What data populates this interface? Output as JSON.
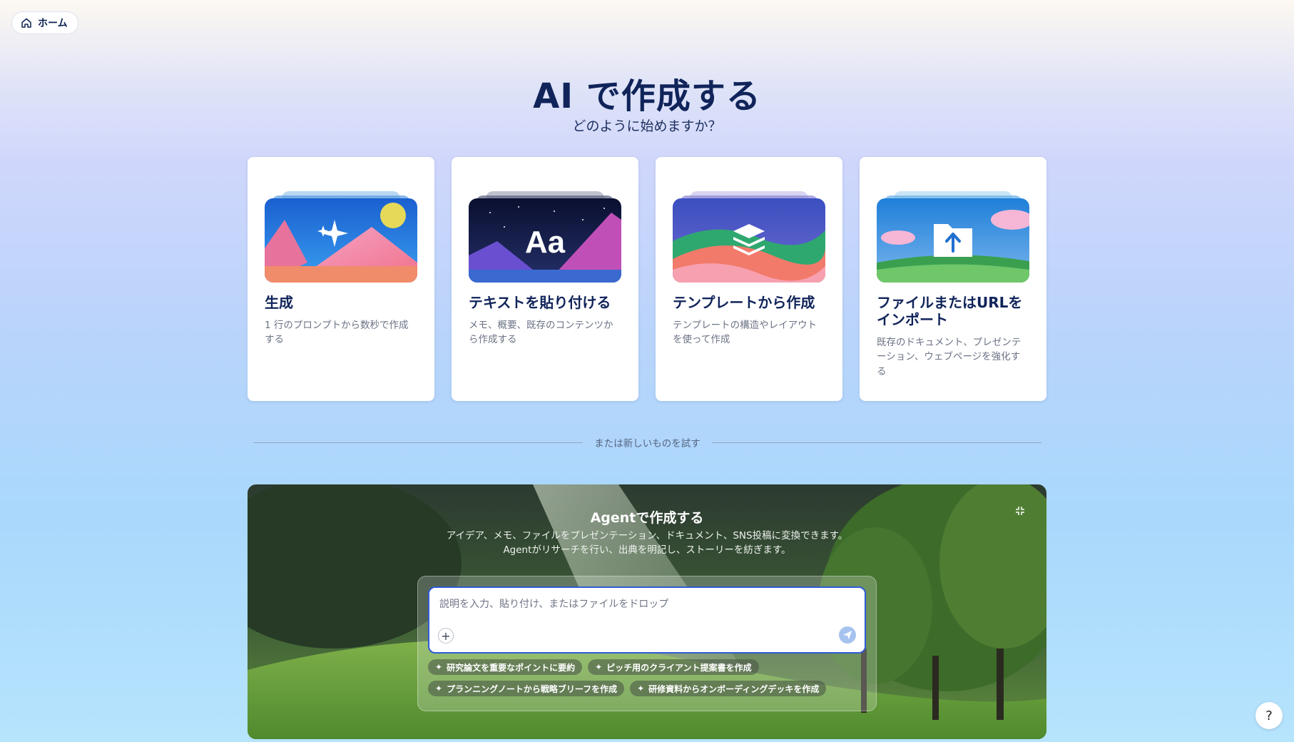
{
  "home": {
    "label": "ホーム",
    "icon": "home-icon"
  },
  "header": {
    "title": "AI で作成する",
    "subtitle": "どのように始めますか？"
  },
  "cards": [
    {
      "title": "生成",
      "desc": "1 行のプロンプトから数秒で作成する"
    },
    {
      "title": "テキストを貼り付ける",
      "desc": "メモ、概要、既存のコンテンツから作成する"
    },
    {
      "title": "テンプレートから作成",
      "desc": "テンプレートの構造やレイアウトを使って作成"
    },
    {
      "title": "ファイルまたはURLをインポート",
      "desc": "既存のドキュメント、プレゼンテーション、ウェブページを強化する"
    }
  ],
  "divider": {
    "label": "または新しいものを試す"
  },
  "agent": {
    "title": "Agentで作成する",
    "desc_line1": "アイデア、メモ、ファイルをプレゼンテーション、ドキュメント、SNS投稿に変換できます。",
    "desc_line2": "Agentがリサーチを行い、出典を明記し、ストーリーを紡ぎます。",
    "placeholder": "説明を入力、貼り付け、またはファイルをドロップ",
    "chips": [
      "研究論文を重要なポイントに要約",
      "ピッチ用のクライアント提案書を作成",
      "プランニングノートから戦略ブリーフを作成",
      "研修資料からオンボーディングデッキを作成"
    ]
  },
  "help": {
    "label": "?"
  },
  "colors": {
    "accent": "#2f5bd6",
    "title": "#10245a"
  }
}
